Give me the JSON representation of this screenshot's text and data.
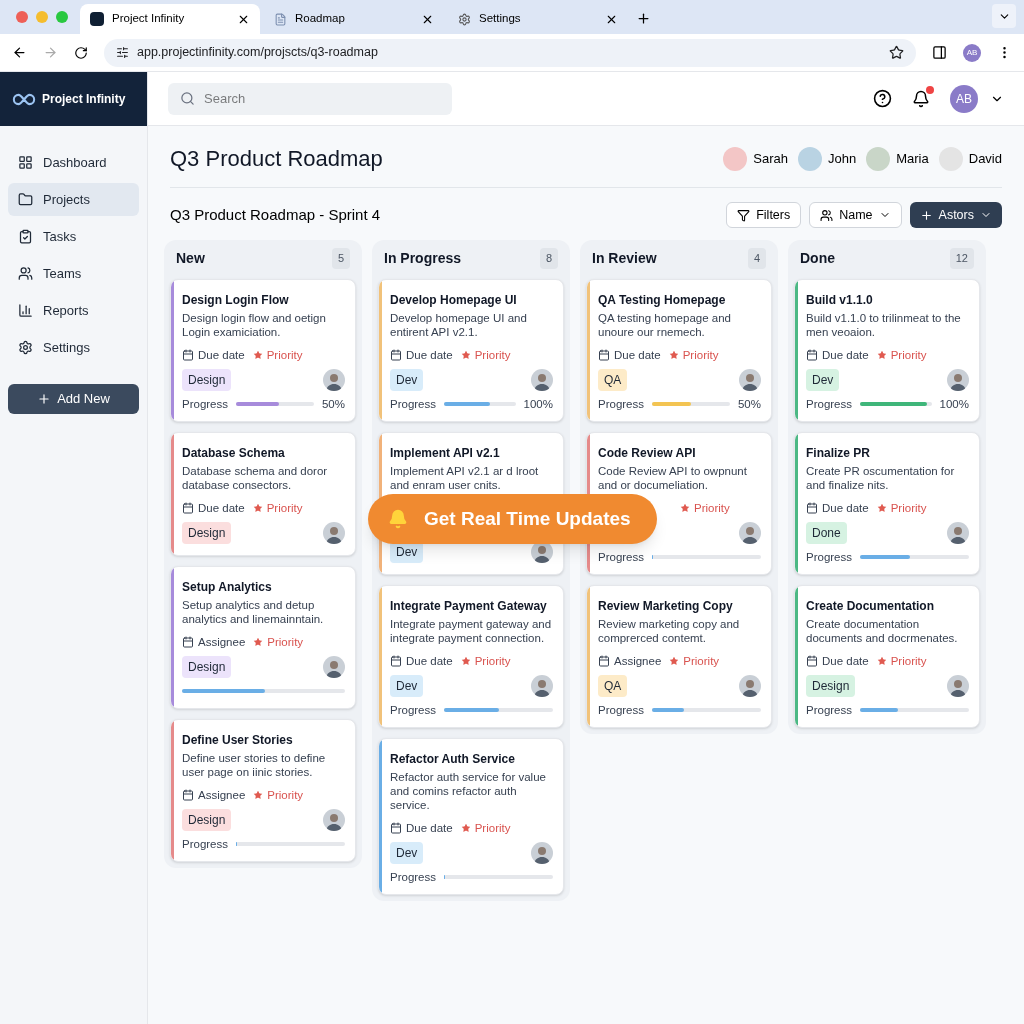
{
  "browser": {
    "tabs": [
      {
        "title": "Project Infinity",
        "selected": true,
        "kind": "logo"
      },
      {
        "title": "Roadmap",
        "selected": false,
        "kind": "doc"
      },
      {
        "title": "Settings",
        "selected": false,
        "kind": "gear"
      }
    ],
    "url": "app.projectinfinity.com/projscts/q3-roadmap",
    "profile": "AB"
  },
  "brand": "Project Infinity",
  "search": {
    "placeholder": "Search"
  },
  "user": {
    "initials": "AB",
    "notification": true
  },
  "sidebar": {
    "items": [
      {
        "label": "Dashboard",
        "selected": false
      },
      {
        "label": "Projects",
        "selected": true
      },
      {
        "label": "Tasks",
        "selected": false
      },
      {
        "label": "Teams",
        "selected": false
      },
      {
        "label": "Reports",
        "selected": false
      },
      {
        "label": "Settings",
        "selected": false
      }
    ],
    "add_button": "Add New"
  },
  "page_title": "Q3 Product Roadmap",
  "members": [
    {
      "name": "Sarah",
      "color": "#f3c6c6"
    },
    {
      "name": "John",
      "color": "#b9d3e3"
    },
    {
      "name": "Maria",
      "color": "#c9d6c8"
    },
    {
      "name": "David",
      "color": "#e4e4e4"
    }
  ],
  "subtitle": "Q3 Product Roadmap - Sprint 4",
  "toolbar": {
    "filters": "Filters",
    "name": "Name",
    "action": "Astors"
  },
  "columns": [
    {
      "title": "New",
      "count": "5",
      "cards": [
        {
          "title": "Design Login Flow",
          "desc": "Design login flow and oetign Login examiciation.",
          "meta": "Due date",
          "priority": "Priority",
          "color": "#a78bdb",
          "tag": {
            "label": "Design",
            "color": "#ece3fb"
          },
          "progress": {
            "label": "Progress",
            "level": 0.55,
            "reading": "50%",
            "color": "#a78bdb"
          }
        },
        {
          "title": "Database Schema",
          "desc": "Database schema and doror database consectors.",
          "meta": "Due date",
          "priority": "Priority",
          "color": "#e58a8a",
          "tag": {
            "label": "Design",
            "color": "#fbdede"
          }
        },
        {
          "title": "Setup Analytics",
          "desc": "Setup analytics and detup analytics and linemainntain.",
          "meta": "Assignee",
          "priority": "Priority",
          "color": "#a78bdb",
          "tag": {
            "label": "Design",
            "color": "#ece3fb"
          },
          "progress": {
            "level": 0.51,
            "color": "#6aaee6"
          }
        },
        {
          "title": "Define User Stories",
          "desc": "Define user stories to define user page on iinic stories.",
          "meta": "Assignee",
          "priority": "Priority",
          "color": "#e58a8a",
          "tag": {
            "label": "Design",
            "color": "#fbdede"
          },
          "progress": {
            "label": "Progress",
            "level": 0
          }
        }
      ]
    },
    {
      "title": "In Progress",
      "count": "8",
      "cards": [
        {
          "title": "Develop Homepage UI",
          "desc": "Develop homepage UI and entirent API v2.1.",
          "meta": "Due date",
          "priority": "Priority",
          "color": "#f1c27a",
          "tag": {
            "label": "Dev",
            "color": "#d8ecfa"
          },
          "progress": {
            "label": "Progress",
            "level": 0.64,
            "reading": "100%",
            "color": "#6aaee6"
          }
        },
        {
          "title": "Implement API v2.1",
          "desc": "Implement API v2.1 ar d lroot and enram user cnits.",
          "color": "#f1b27a",
          "tag": {
            "label": "Dev",
            "color": "#d8ecfa"
          }
        },
        {
          "title": "Integrate Payment Gateway",
          "desc": "Integrate payment gateway and integrate payment connection.",
          "meta": "Due date",
          "priority": "Priority",
          "color": "#f1c27a",
          "tag": {
            "label": "Dev",
            "color": "#d8ecfa"
          },
          "progress": {
            "label": "Progress",
            "level": 0.5,
            "color": "#6aaee6"
          }
        },
        {
          "title": "Refactor Auth Service",
          "desc": "Refactor auth service for value and comins refactor auth service.",
          "meta": "Due date",
          "priority": "Priority",
          "color": "#6aaee6",
          "tag": {
            "label": "Dev",
            "color": "#d8ecfa"
          },
          "progress": {
            "label": "Progress",
            "level": 0
          }
        }
      ]
    },
    {
      "title": "In Review",
      "count": "4",
      "cards": [
        {
          "title": "QA Testing Homepage",
          "desc": "QA testing homepage and unoure our rnemech.",
          "meta": "Due date",
          "priority": "Priority",
          "color": "#f1c27a",
          "tag": {
            "label": "QA",
            "color": "#fdebc8"
          },
          "progress": {
            "label": "Progress",
            "level": 0.5,
            "reading": "50%",
            "color": "#f3c452"
          }
        },
        {
          "title": "Code Review API",
          "desc": "Code Review API to owpnunt and or documeliation.",
          "priority": "Priority",
          "color": "#e58a8a",
          "progress": {
            "label": "Progress",
            "level": 0
          }
        },
        {
          "title": "Review Marketing Copy",
          "desc": "Review marketing copy and comprerced contemt.",
          "meta": "Assignee",
          "priority": "Priority",
          "color": "#f1c27a",
          "tag": {
            "label": "QA",
            "color": "#fdebc8"
          },
          "progress": {
            "label": "Progress",
            "level": 0.29,
            "color": "#6aaee6"
          }
        }
      ]
    },
    {
      "title": "Done",
      "count": "12",
      "cards": [
        {
          "title": "Build v1.1.0",
          "desc": "Build v1.1.0 to trilinmeat to the men veoaion.",
          "meta": "Due date",
          "priority": "Priority",
          "color": "#4cb884",
          "tag": {
            "label": "Dev",
            "color": "#d6f2e2"
          },
          "progress": {
            "label": "Progress",
            "level": 0.93,
            "reading": "100%",
            "color": "#3fb67a"
          }
        },
        {
          "title": "Finalize PR",
          "desc": "Create PR oscumentation for and finalize nits.",
          "meta": "Due date",
          "priority": "Priority",
          "color": "#4cb884",
          "tag": {
            "label": "Done",
            "color": "#d6f2e2"
          },
          "progress": {
            "label": "Progress",
            "level": 0.46,
            "color": "#6aaee6"
          }
        },
        {
          "title": "Create Documentation",
          "desc": "Create documentation documents and docrmenates.",
          "meta": "Due date",
          "priority": "Priority",
          "color": "#4cb884",
          "tag": {
            "label": "Design",
            "color": "#d6f2e2"
          },
          "progress": {
            "label": "Progress",
            "level": 0.35,
            "color": "#6aaee6"
          }
        }
      ]
    }
  ],
  "toast": {
    "text": "Get Real Time Updates"
  }
}
